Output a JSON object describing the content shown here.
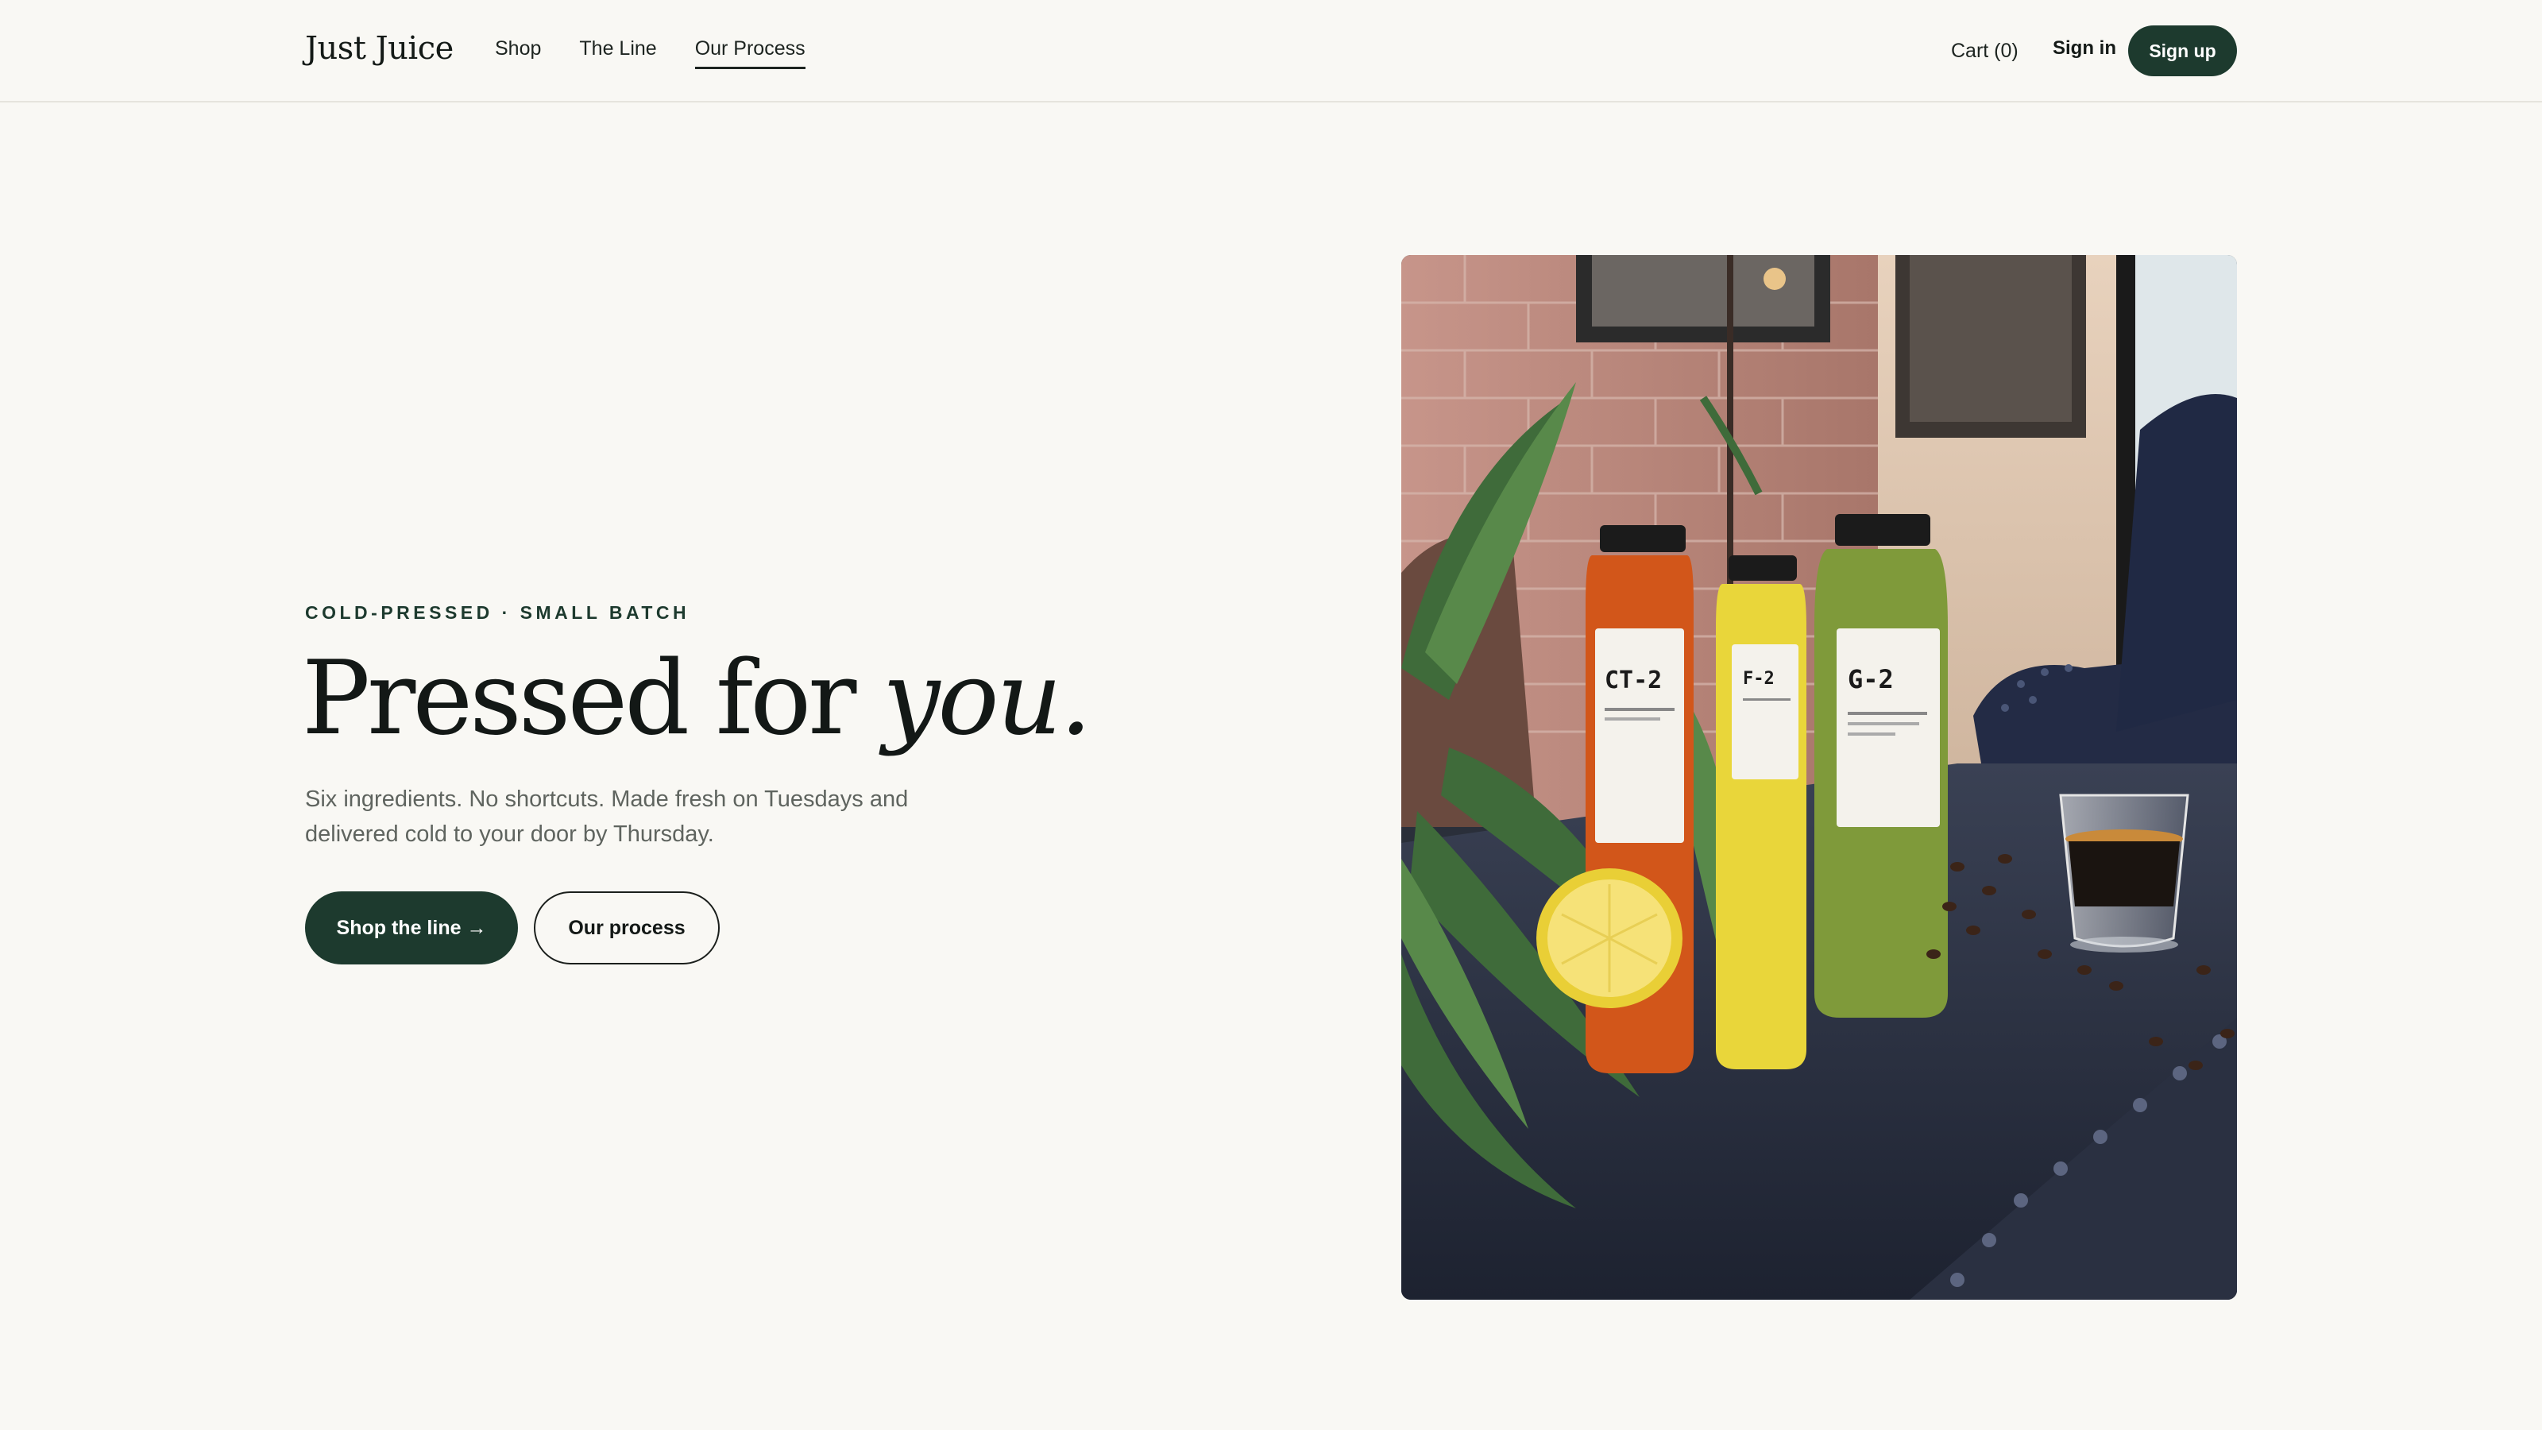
{
  "header": {
    "logo": "Just Juice",
    "nav": [
      {
        "label": "Shop",
        "active": false
      },
      {
        "label": "The Line",
        "active": false
      },
      {
        "label": "Our Process",
        "active": true
      }
    ],
    "cart_label": "Cart (0)",
    "signin_label": "Sign in",
    "signup_label": "Sign up"
  },
  "hero": {
    "eyebrow": "COLD-PRESSED · SMALL BATCH",
    "headline_main": "Pressed for ",
    "headline_em": "you.",
    "subcopy": "Six ingredients. No shortcuts. Made fresh on Tuesdays and delivered cold to your door by Thursday.",
    "primary_cta": "Shop the line →",
    "secondary_cta": "Our process"
  },
  "photo": {
    "bottles": [
      {
        "code": "CT-2",
        "color": "#d2561a"
      },
      {
        "code": "F-2",
        "color": "#e9d63a"
      },
      {
        "code": "G-2",
        "color": "#7f9a3a"
      }
    ]
  },
  "colors": {
    "background": "#f9f8f4",
    "brand_green": "#1d3a2e",
    "text": "#131816",
    "muted": "#5f645f"
  }
}
